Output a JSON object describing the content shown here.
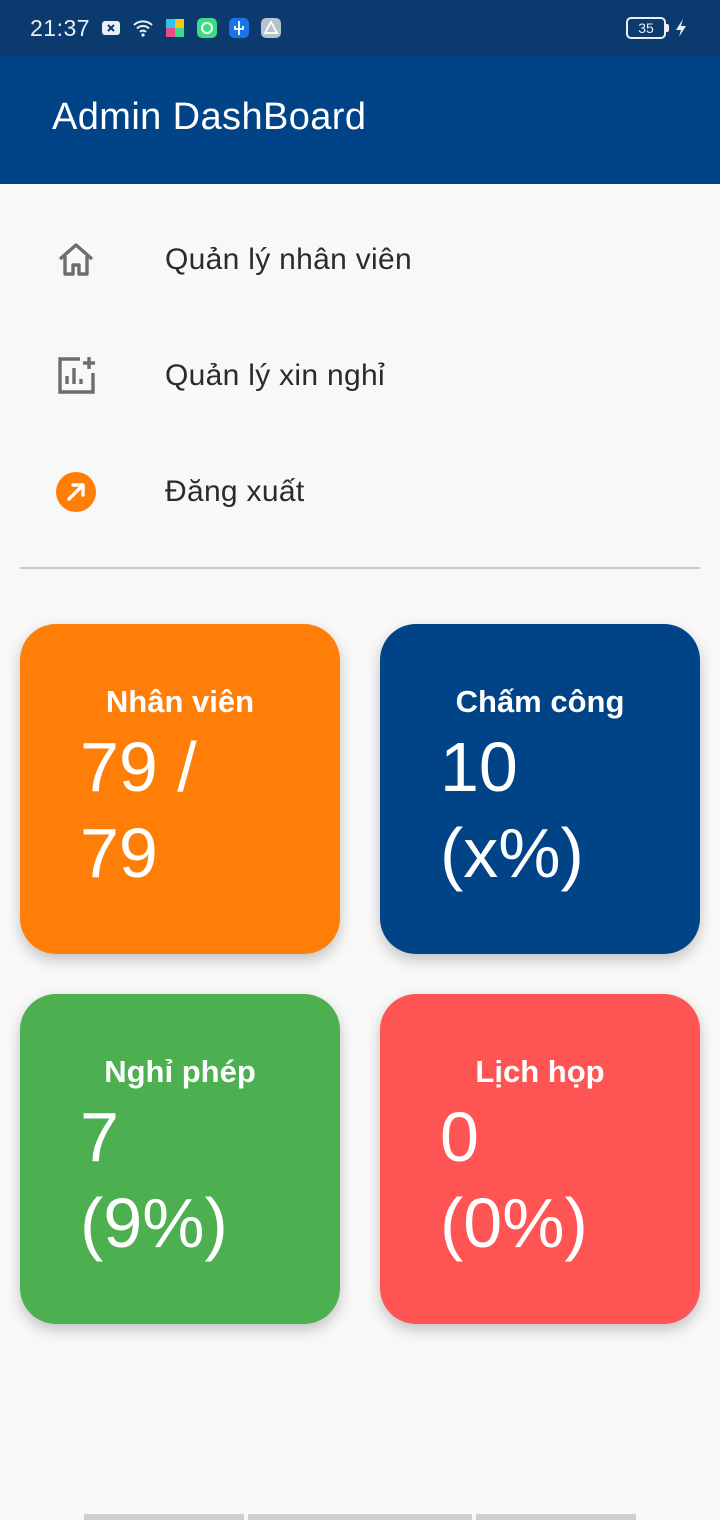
{
  "status_bar": {
    "time": "21:37",
    "battery": "35",
    "icons": [
      "notification-x-icon",
      "wifi-icon",
      "puzzle-icon",
      "vpn-icon",
      "usb-icon",
      "android-debug-icon",
      "charging-icon"
    ]
  },
  "app_bar": {
    "title": "Admin DashBoard",
    "color": "#004386"
  },
  "menu": {
    "items": [
      {
        "label": "Quản lý nhân viên",
        "icon": "home-icon"
      },
      {
        "label": "Quản lý xin nghỉ",
        "icon": "add-chart-icon"
      },
      {
        "label": "Đăng xuất",
        "icon": "logout-icon"
      }
    ]
  },
  "cards": [
    {
      "title": "Nhân viên",
      "value": "79 /\n79",
      "color": "#ff7e07"
    },
    {
      "title": "Chấm công",
      "value": "10\n(x%)",
      "color": "#004386"
    },
    {
      "title": "Nghỉ phép",
      "value": "7\n(9%)",
      "color": "#4caf50"
    },
    {
      "title": "Lịch họp",
      "value": "0\n(0%)",
      "color": "#ff5454"
    }
  ]
}
